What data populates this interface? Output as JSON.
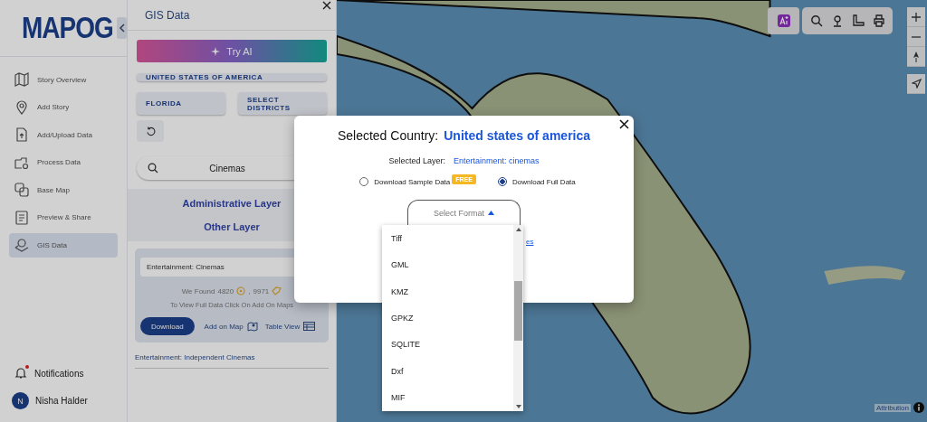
{
  "sidebar": {
    "logo": "MAPOG",
    "items": [
      {
        "label": "Story Overview",
        "selected": false
      },
      {
        "label": "Add Story",
        "selected": false
      },
      {
        "label": "Add/Upload Data",
        "selected": false
      },
      {
        "label": "Process Data",
        "selected": false
      },
      {
        "label": "Base Map",
        "selected": false
      },
      {
        "label": "Preview & Share",
        "selected": false
      },
      {
        "label": "GIS Data",
        "selected": true
      }
    ],
    "notifications": {
      "label": "Notifications",
      "unread": true
    },
    "user": {
      "initial": "N",
      "name": "Nisha Halder"
    }
  },
  "panel": {
    "title": "GIS Data",
    "try_ai": "Try AI",
    "country": "UNITED STATES OF AMERICA",
    "state": "FLORIDA",
    "districts": "SELECT DISTRICTS",
    "search": {
      "value": "Cinemas"
    },
    "sections": [
      "Administrative Layer",
      "Other Layer"
    ],
    "result_card": {
      "layer": "Entertainment: Cinemas",
      "found_label": "We Found",
      "counts": [
        {
          "value": "4820",
          "kind": "point"
        },
        {
          "value": "9971",
          "kind": "polygon"
        }
      ],
      "separator": ",",
      "hint": "To View Full Data Click On Add On Maps",
      "download": "Download",
      "add_on_map": "Add on Map",
      "table_view": "Table View"
    },
    "layers": [
      "Entertainment: Independent Cinemas"
    ]
  },
  "map": {
    "attribution": "Attribution"
  },
  "modal": {
    "country_label": "Selected Country:",
    "country": "United states of america",
    "layer_label": "Selected Layer:",
    "layer": "Entertainment: cinemas",
    "options": [
      {
        "label": "Download Sample Data",
        "badge": "FREE",
        "selected": false
      },
      {
        "label": "Download Full Data",
        "selected": true
      }
    ],
    "format": {
      "placeholder": "Select Format",
      "expanded": true,
      "options": [
        "Tiff",
        "GML",
        "KMZ",
        "GPKZ",
        "SQLITE",
        "Dxf",
        "MIF"
      ]
    },
    "link": "es"
  }
}
